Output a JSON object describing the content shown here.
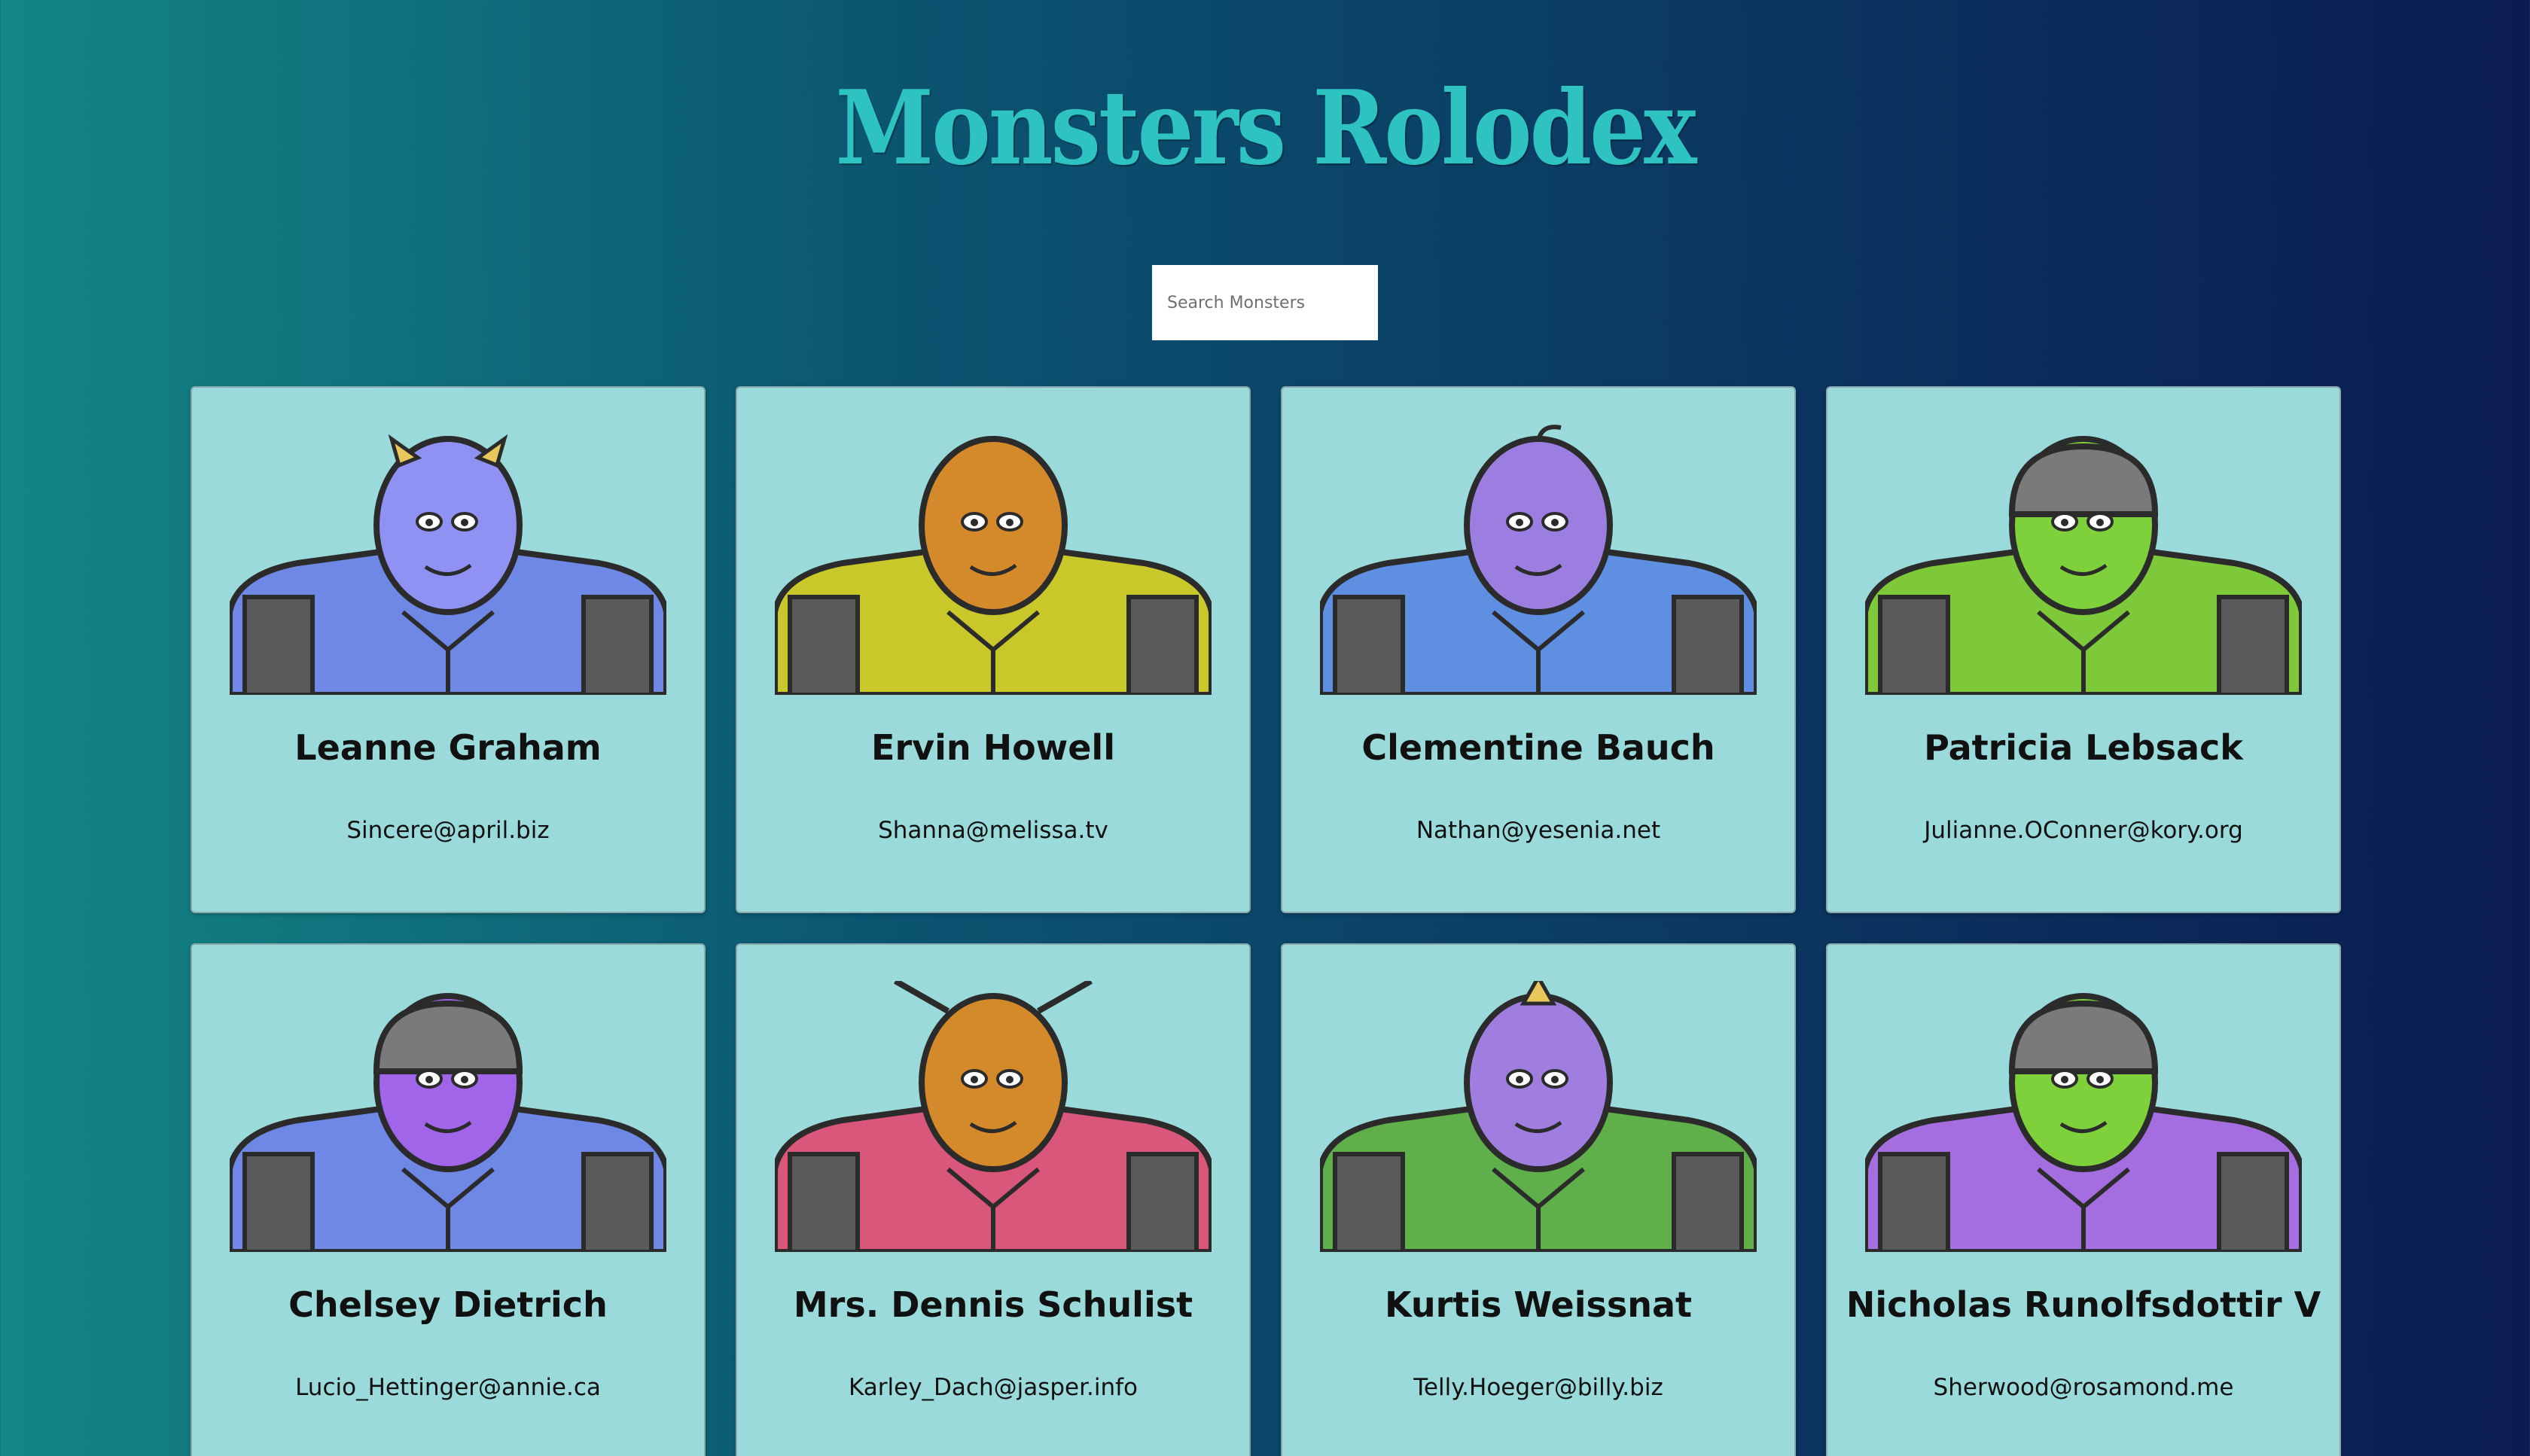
{
  "app": {
    "title": "Monsters Rolodex"
  },
  "search": {
    "placeholder": "Search Monsters",
    "value": ""
  },
  "monsters": [
    {
      "name": "Leanne Graham",
      "email": "Sincere@april.biz",
      "skin": "#8f92f2",
      "body": "#6f88e6",
      "feature": "horns"
    },
    {
      "name": "Ervin Howell",
      "email": "Shanna@melissa.tv",
      "skin": "#d48a2a",
      "body": "#c8c82a",
      "feature": "none"
    },
    {
      "name": "Clementine Bauch",
      "email": "Nathan@yesenia.net",
      "skin": "#9b7ee0",
      "body": "#5f8fe0",
      "feature": "antenna"
    },
    {
      "name": "Patricia Lebsack",
      "email": "Julianne.OConner@kory.org",
      "skin": "#7fd13b",
      "body": "#7dc93a",
      "feature": "helmet"
    },
    {
      "name": "Chelsey Dietrich",
      "email": "Lucio_Hettinger@annie.ca",
      "skin": "#a065e8",
      "body": "#6f88e6",
      "feature": "helmet"
    },
    {
      "name": "Mrs. Dennis Schulist",
      "email": "Karley_Dach@jasper.info",
      "skin": "#d48a2a",
      "body": "#d8577a",
      "feature": "antennae"
    },
    {
      "name": "Kurtis Weissnat",
      "email": "Telly.Hoeger@billy.biz",
      "skin": "#a07ee0",
      "body": "#5fb04a",
      "feature": "horn"
    },
    {
      "name": "Nicholas Runolfsdottir V",
      "email": "Sherwood@rosamond.me",
      "skin": "#7fd13b",
      "body": "#a56ee0",
      "feature": "helmet"
    }
  ]
}
